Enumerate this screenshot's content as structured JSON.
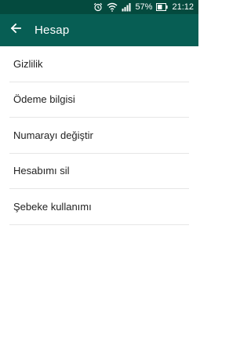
{
  "status_bar": {
    "battery_percent": "57%",
    "time": "21:12",
    "icons": [
      "alarm-icon",
      "wifi-icon",
      "signal-icon",
      "battery-icon"
    ]
  },
  "app_bar": {
    "title": "Hesap",
    "back_icon": "back-arrow-icon",
    "color": "#075e54"
  },
  "menu": {
    "items": [
      {
        "label": "Gizlilik"
      },
      {
        "label": "Ödeme bilgisi"
      },
      {
        "label": "Numarayı değiştir"
      },
      {
        "label": "Hesabımı sil"
      },
      {
        "label": "Şebeke kullanımı"
      }
    ]
  }
}
